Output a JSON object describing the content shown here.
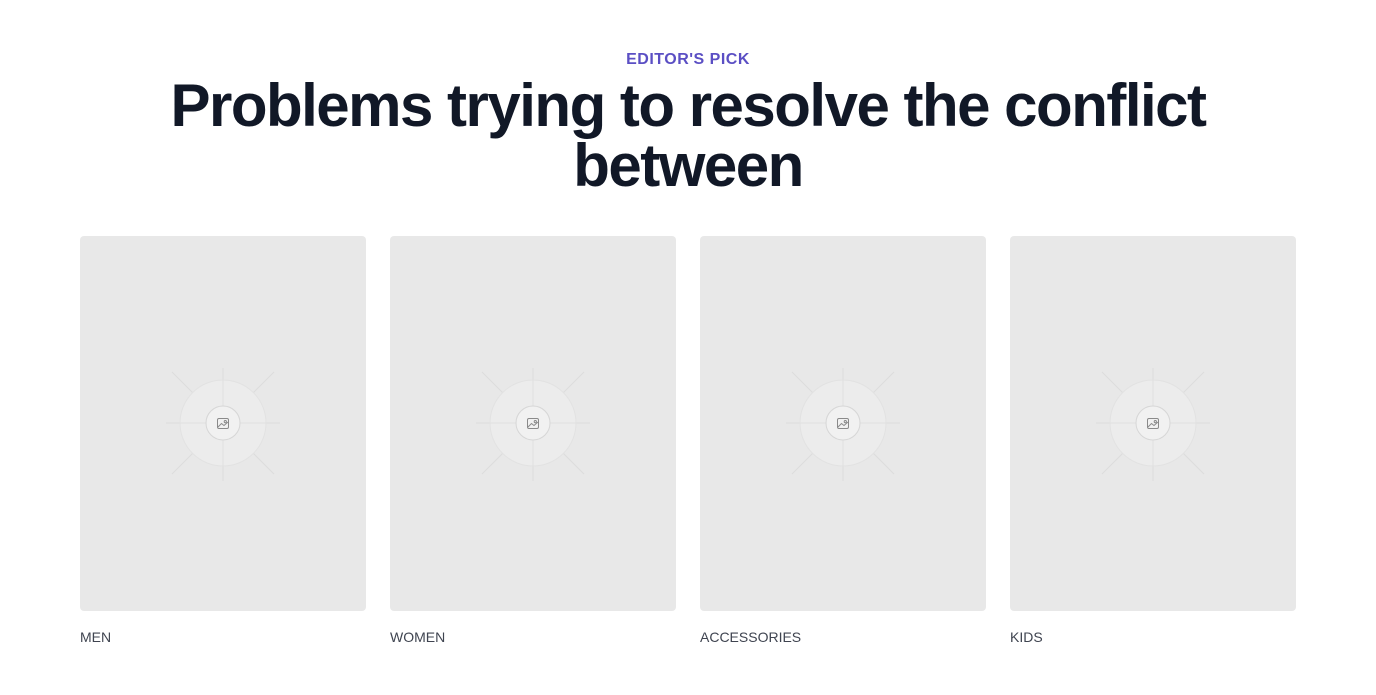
{
  "section": {
    "eyebrow": "EDITOR'S PICK",
    "headline": "Problems trying to resolve the conflict between"
  },
  "categories": [
    {
      "label": "MEN",
      "icon": "image-placeholder-icon"
    },
    {
      "label": "WOMEN",
      "icon": "image-placeholder-icon"
    },
    {
      "label": "ACCESSORIES",
      "icon": "image-placeholder-icon"
    },
    {
      "label": "KIDS",
      "icon": "image-placeholder-icon"
    }
  ],
  "colors": {
    "eyebrow": "#5b4fc4",
    "headline": "#111827",
    "card_background": "#e8e8e8",
    "label": "#3f4450"
  }
}
